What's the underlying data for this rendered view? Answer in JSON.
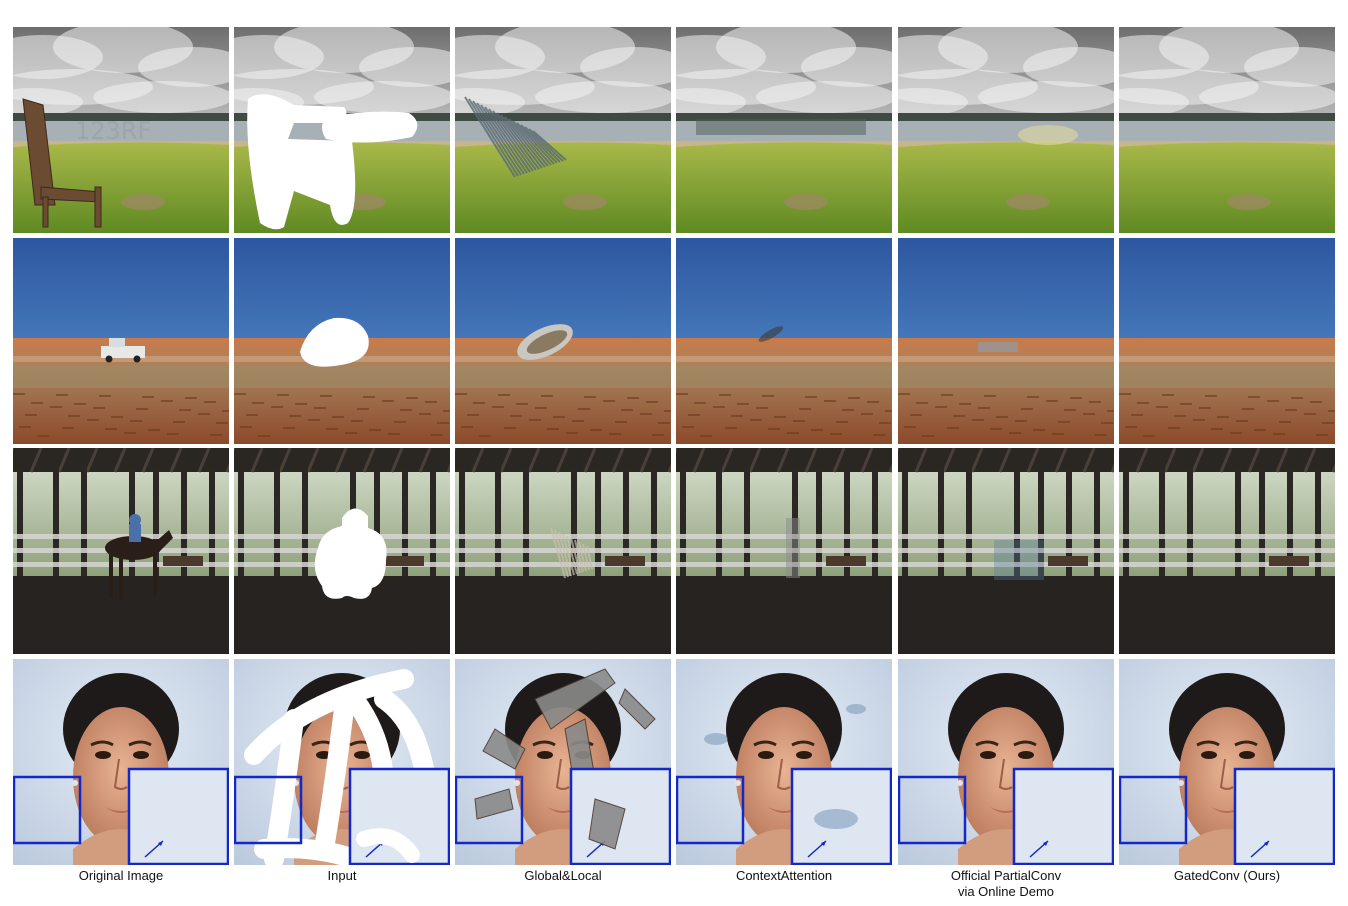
{
  "columns": [
    {
      "caption_lines": [
        "Original Image"
      ]
    },
    {
      "caption_lines": [
        "Input"
      ]
    },
    {
      "caption_lines": [
        "Global&Local"
      ]
    },
    {
      "caption_lines": [
        "ContextAttention"
      ]
    },
    {
      "caption_lines": [
        "Official PartialConv",
        "via Online Demo"
      ]
    },
    {
      "caption_lines": [
        "GatedConv (Ours)"
      ]
    }
  ],
  "rows": [
    {
      "scene": "cloudy-lake-bench"
    },
    {
      "scene": "desert-outback-truck"
    },
    {
      "scene": "horse-arena"
    },
    {
      "scene": "face-portrait"
    }
  ],
  "watermark": "123RF",
  "colors": {
    "mask": "#ffffff",
    "zoom_box": "#1428c8",
    "sky_blue": "#3a6cb0",
    "grass": "#86a432",
    "soil": "#b86a3c"
  }
}
